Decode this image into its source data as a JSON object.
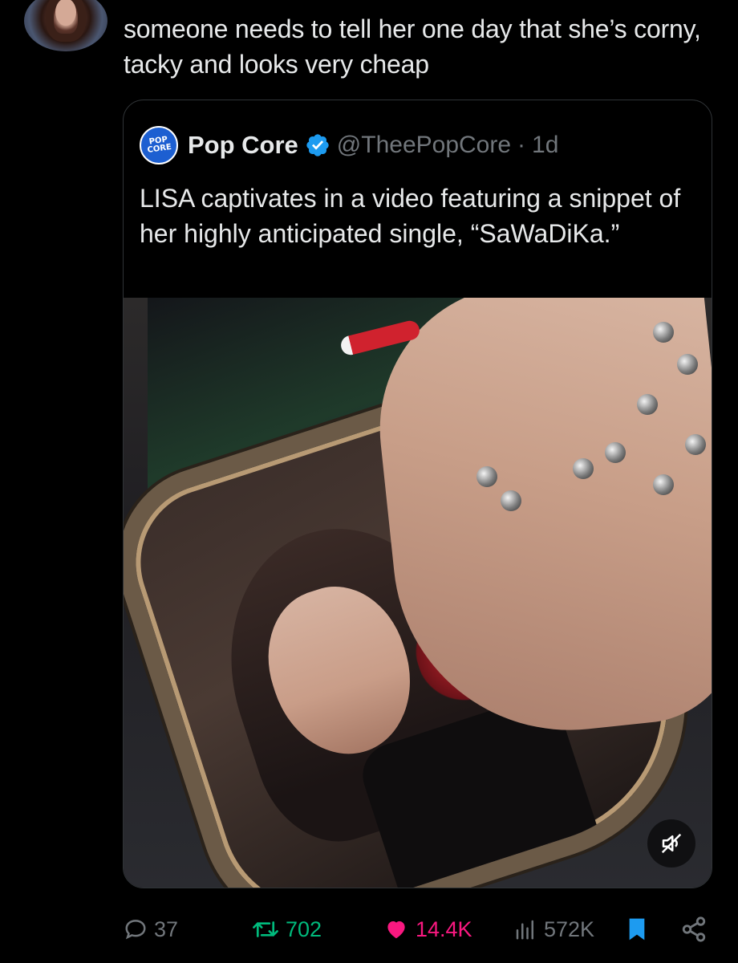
{
  "reply": {
    "text": "someone needs to tell her one day that she’s corny, tacky and looks very cheap"
  },
  "quoted_tweet": {
    "avatar_logo_line1": "POP",
    "avatar_logo_line2": "CORE",
    "display_name": "Pop Core",
    "handle": "@TheePopCore",
    "separator": "·",
    "time": "1d",
    "text": "LISA captivates in a video featuring a snippet of her highly anticipated single, “SaWaDiKa.”",
    "media": {
      "type": "video",
      "muted_icon": "speaker-muted-icon"
    }
  },
  "actions": {
    "replies": "37",
    "reposts": "702",
    "likes": "14.4K",
    "views": "572K"
  },
  "colors": {
    "background": "#000000",
    "text": "#e7e9ea",
    "muted": "#71767b",
    "border": "#2f3336",
    "repost_active": "#00ba7c",
    "like_active": "#f91880",
    "bookmark_active": "#1d9bf0",
    "verified": "#1d9bf0"
  },
  "icons": [
    "reply-icon",
    "repost-icon",
    "heart-icon",
    "views-icon",
    "bookmark-icon",
    "share-icon",
    "verified-badge-icon"
  ]
}
